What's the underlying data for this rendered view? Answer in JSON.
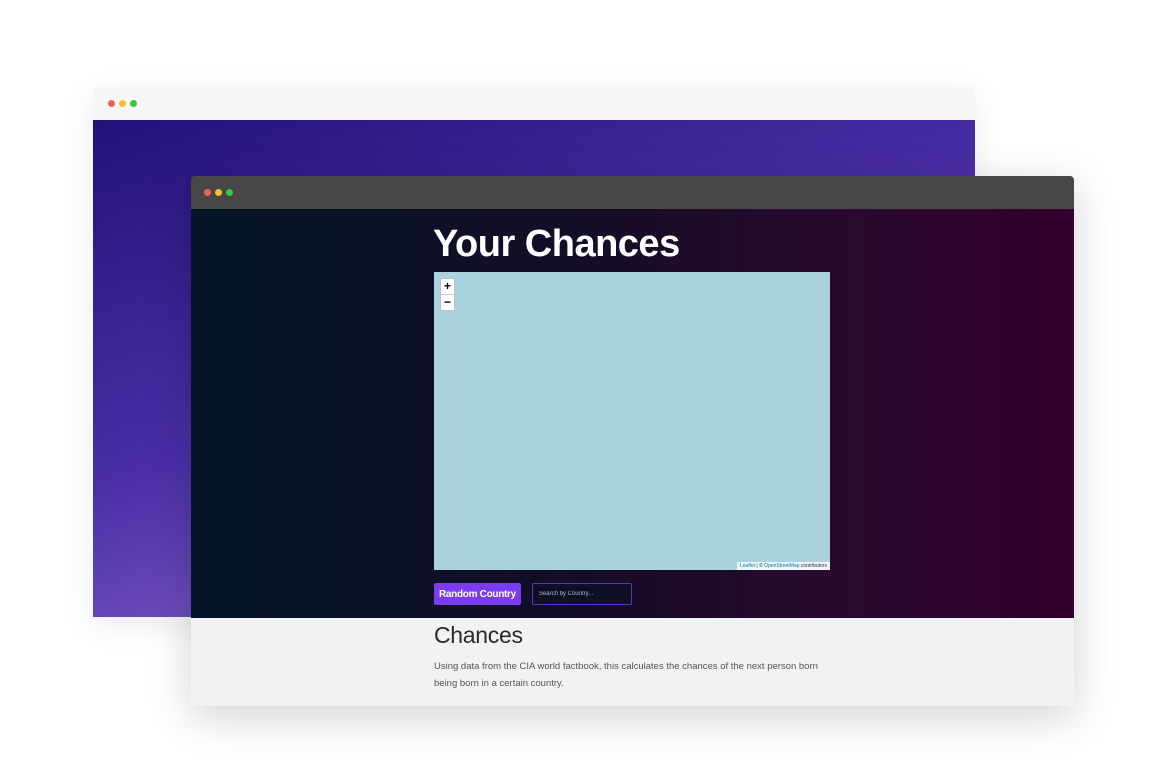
{
  "back_window": {
    "accent_gradient": [
      "#231178",
      "#4a2fa6",
      "#a47ddc"
    ]
  },
  "hero": {
    "title": "Your Chances",
    "background_colors": [
      "#041628",
      "#33002f"
    ]
  },
  "map": {
    "zoom_in_label": "+",
    "zoom_out_label": "−",
    "attribution_leaflet": "Leaflet",
    "attribution_sep": " | © ",
    "attribution_osm": "OpenStreetMap",
    "attribution_suffix": " contributors",
    "water_color": "#aad3df"
  },
  "controls": {
    "random_label": "Random Country",
    "search_placeholder": "Search by Country...",
    "accent": "#7a3cf0"
  },
  "section": {
    "title": "Chances",
    "description": "Using data from the CIA world factbook, this calculates the chances of the next person born being born in a certain country."
  }
}
